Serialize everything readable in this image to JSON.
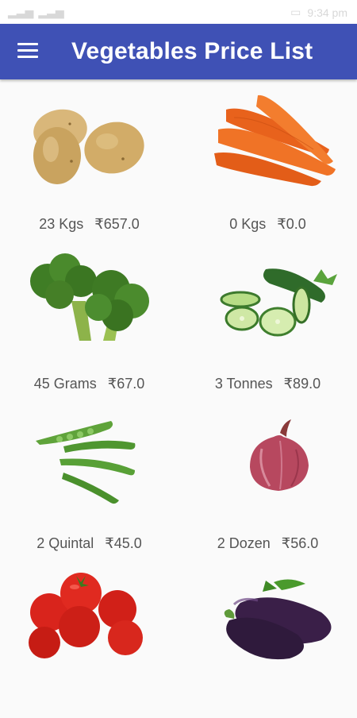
{
  "app": {
    "title": "Vegetables Price List"
  },
  "status_bar": {
    "time": "9:34 pm"
  },
  "items": [
    {
      "name": "potato-item",
      "quantity": "23 Kgs",
      "price": "₹657.0",
      "icon": "potato-image"
    },
    {
      "name": "carrot-item",
      "quantity": "0 Kgs",
      "price": "₹0.0",
      "icon": "carrot-image"
    },
    {
      "name": "broccoli-item",
      "quantity": "45 Grams",
      "price": "₹67.0",
      "icon": "broccoli-image"
    },
    {
      "name": "cucumber-item",
      "quantity": "3 Tonnes",
      "price": "₹89.0",
      "icon": "cucumber-image"
    },
    {
      "name": "peas-item",
      "quantity": "2 Quintal",
      "price": "₹45.0",
      "icon": "peas-image"
    },
    {
      "name": "onion-item",
      "quantity": "2 Dozen",
      "price": "₹56.0",
      "icon": "onion-image"
    },
    {
      "name": "tomato-item",
      "quantity": "",
      "price": "",
      "icon": "tomato-image"
    },
    {
      "name": "eggplant-item",
      "quantity": "",
      "price": "",
      "icon": "eggplant-image"
    }
  ],
  "colors": {
    "appbar": "#3f51b5",
    "background": "#fafafa",
    "caption_text": "#555555"
  }
}
